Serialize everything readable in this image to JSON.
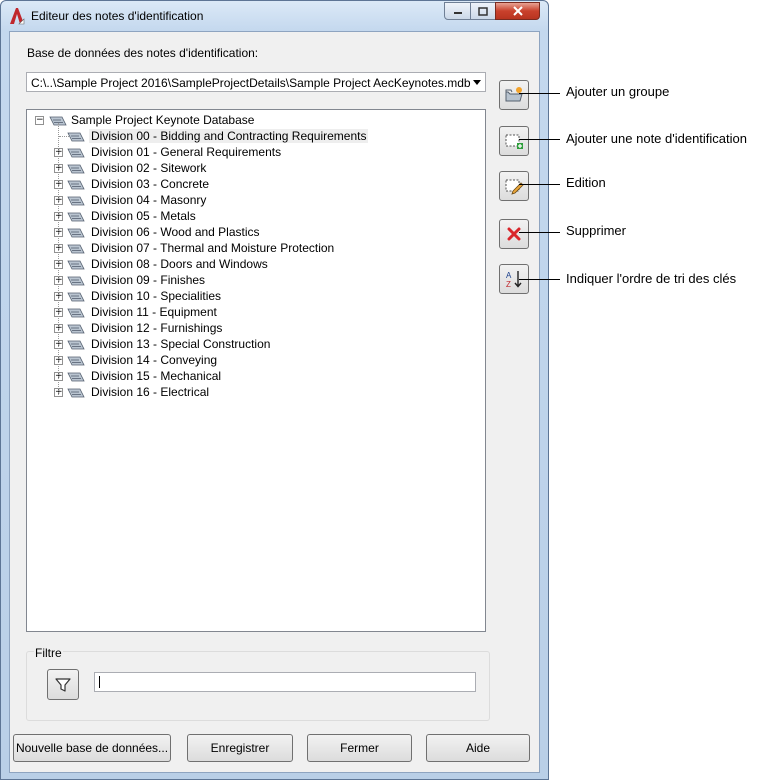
{
  "window": {
    "title": "Editeur des notes d'identification"
  },
  "database": {
    "label": "Base de données des notes d'identification:",
    "path": "C:\\..\\Sample Project 2016\\SampleProjectDetails\\Sample Project AecKeynotes.mdb"
  },
  "tree": {
    "root": "Sample Project Keynote Database",
    "selected_index": 0,
    "items": [
      "Division 00 - Bidding and Contracting Requirements",
      "Division 01 - General Requirements",
      "Division 02 - Sitework",
      "Division 03 - Concrete",
      "Division 04 - Masonry",
      "Division 05 - Metals",
      "Division 06 - Wood and Plastics",
      "Division 07 - Thermal and Moisture Protection",
      "Division 08 - Doors and Windows",
      "Division 09 - Finishes",
      "Division 10 - Specialities",
      "Division 11 - Equipment",
      "Division 12 - Furnishings",
      "Division 13 - Special Construction",
      "Division 14 - Conveying",
      "Division 15 - Mechanical",
      "Division 16 - Electrical"
    ]
  },
  "side_buttons": [
    {
      "icon": "folder-add-icon",
      "callout": "Ajouter un groupe"
    },
    {
      "icon": "add-note-icon",
      "callout": "Ajouter une note d'identification"
    },
    {
      "icon": "edit-icon",
      "callout": "Edition"
    },
    {
      "icon": "delete-icon",
      "callout": "Supprimer"
    },
    {
      "icon": "sort-az-icon",
      "callout": "Indiquer l'ordre de tri des clés"
    }
  ],
  "filter": {
    "label": "Filtre",
    "value": ""
  },
  "buttons": {
    "new_db": "Nouvelle base de données...",
    "save": "Enregistrer",
    "close": "Fermer",
    "help": "Aide"
  },
  "colors": {
    "title_bar": "#c4d8ee",
    "client": "#f0f0f0",
    "delete_red": "#d9262b",
    "selection": "#eeeeee"
  }
}
